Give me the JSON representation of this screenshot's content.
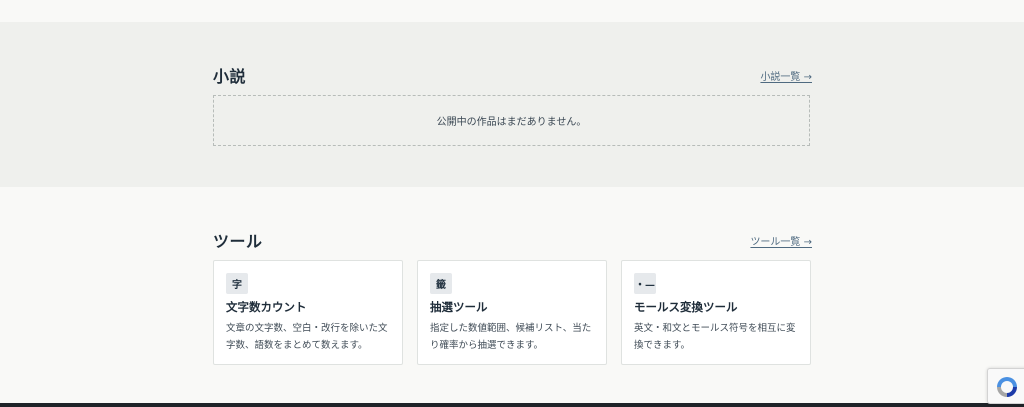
{
  "novels": {
    "title": "小説",
    "more_link": "小説一覧 →",
    "empty_message": "公開中の作品はまだありません。"
  },
  "tools": {
    "title": "ツール",
    "more_link": "ツール一覧 →",
    "items": [
      {
        "icon": "字",
        "name": "文字数カウント",
        "desc": "文章の文字数、空白・改行を除いた文字数、語数をまとめて数えます。"
      },
      {
        "icon": "籤",
        "name": "抽選ツール",
        "desc": "指定した数値範囲、候補リスト、当たり確率から抽選できます。"
      },
      {
        "icon": "・—",
        "name": "モールス変換ツール",
        "desc": "英文・和文とモールス符号を相互に変換できます。"
      }
    ]
  },
  "colors": {
    "novels_bg": "#eff0ed",
    "page_bg": "#f9f9f7",
    "link": "#4f6a80",
    "footer": "#1f2328"
  },
  "icons": {
    "recaptcha": "recaptcha-icon"
  }
}
